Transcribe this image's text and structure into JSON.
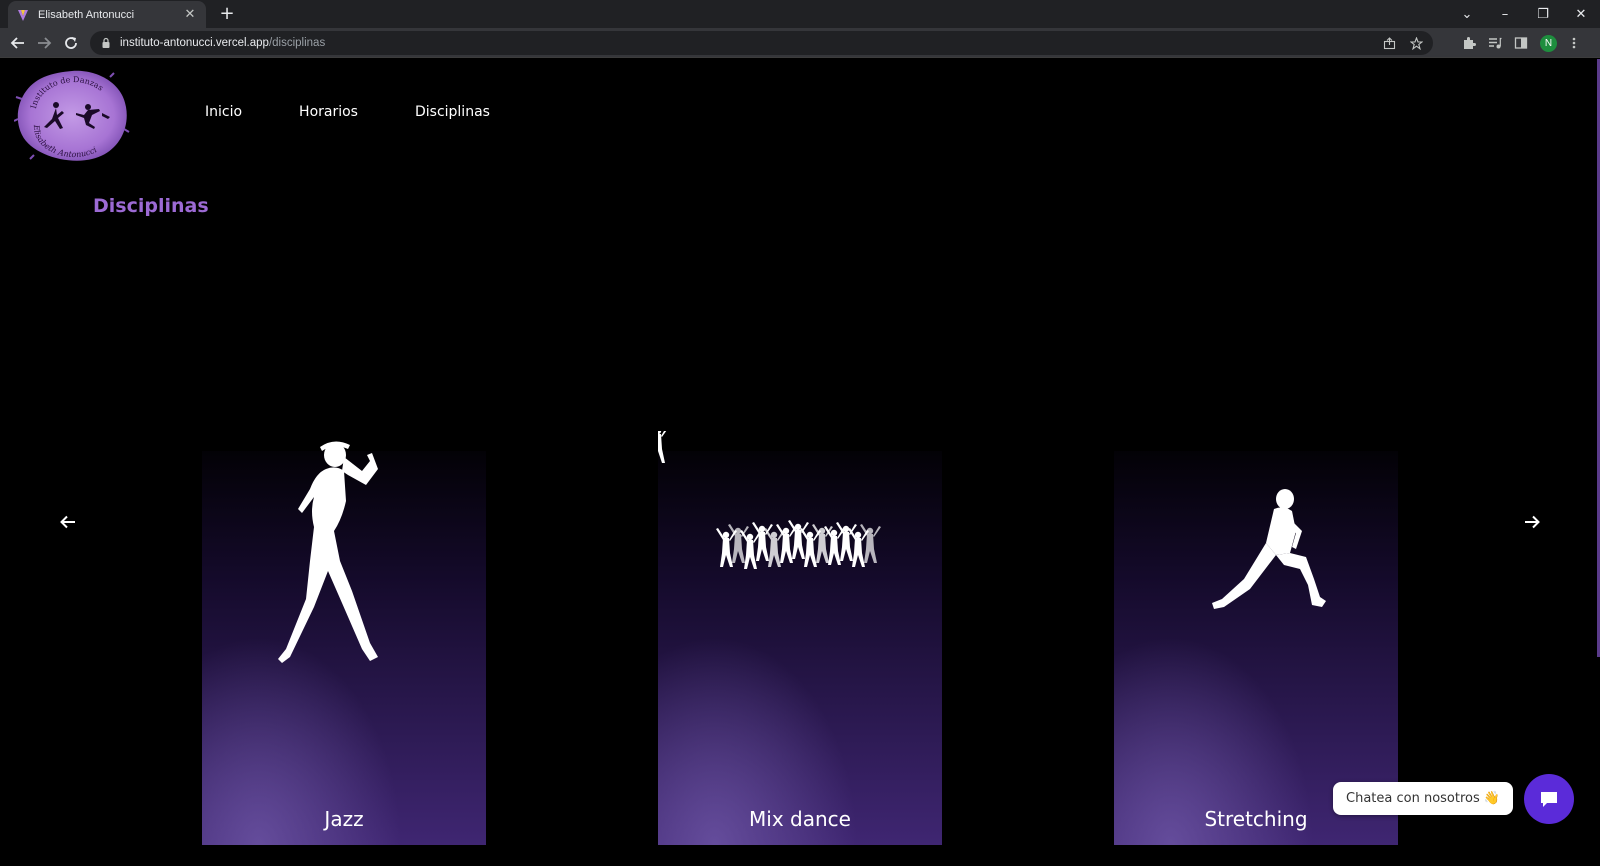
{
  "browser": {
    "tab_title": "Elisabeth Antonucci",
    "tab_close": "✕",
    "new_tab": "+",
    "url_host": "instituto-antonucci.vercel.app",
    "url_path": "/disciplinas",
    "profile_initial": "N",
    "win_dropdown": "⌄",
    "win_minimize": "–",
    "win_restore": "❐",
    "win_close": "✕"
  },
  "site": {
    "logo_text_top": "Instituto de Danzas",
    "logo_text_bottom": "Elisabeth Antonucci",
    "nav": [
      {
        "label": "Inicio"
      },
      {
        "label": "Horarios"
      },
      {
        "label": "Disciplinas"
      }
    ],
    "section_title": "Disciplinas",
    "cards": [
      {
        "label": "Jazz",
        "figure": "jazz-dancer-silhouette"
      },
      {
        "label": "Mix dance",
        "figure": "dance-group-silhouette"
      },
      {
        "label": "Stretching",
        "figure": "stretching-silhouette"
      }
    ],
    "chat": {
      "bubble_text": "Chatea con nosotros 👋"
    }
  },
  "colors": {
    "accent": "#9c6ad4",
    "chat_button": "#5b2bd9",
    "card_gradient_top": "#0a0514",
    "card_gradient_bottom": "#4a2d80"
  }
}
